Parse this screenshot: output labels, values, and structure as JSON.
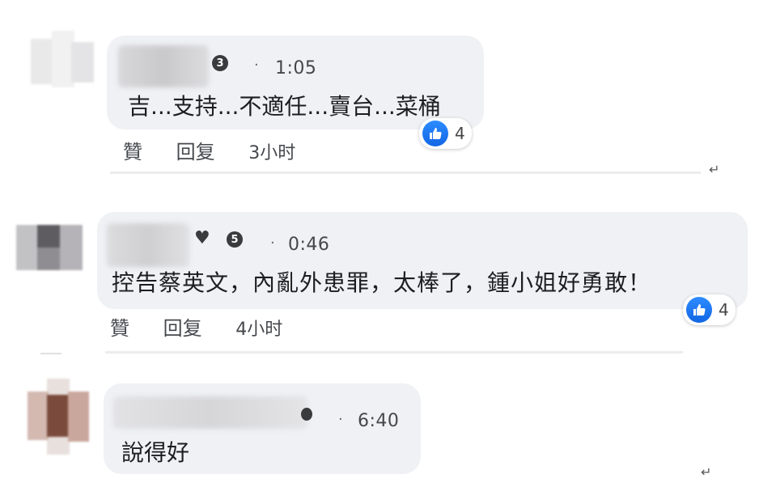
{
  "comments": [
    {
      "time": "1:05",
      "text": "吉...支持...不適任...賣台...菜桶",
      "reaction_count": "4",
      "actions": {
        "like": "贊",
        "reply": "回复",
        "age": "3小时"
      },
      "badge": "3"
    },
    {
      "time": "0:46",
      "text": "控告蔡英文，內亂外患罪，太棒了，鍾小姐好勇敢！",
      "reaction_count": "4",
      "actions": {
        "like": "贊",
        "reply": "回复",
        "age": "4小时"
      },
      "badge": "5"
    },
    {
      "time": "6:40",
      "text": "說得好"
    }
  ],
  "colors": {
    "bubble": "#eff1f4",
    "like_blue": "#1877f2"
  },
  "icons": [
    "like-thumb-icon",
    "heart-icon",
    "reply-arrow-icon",
    "badge-icon"
  ]
}
